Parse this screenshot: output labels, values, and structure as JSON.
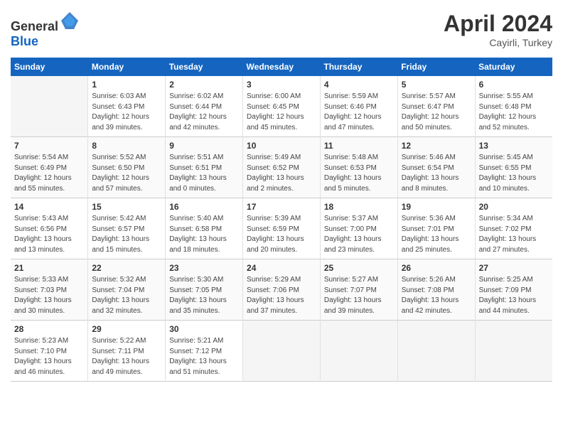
{
  "header": {
    "logo_general": "General",
    "logo_blue": "Blue",
    "month": "April 2024",
    "location": "Cayirli, Turkey"
  },
  "weekdays": [
    "Sunday",
    "Monday",
    "Tuesday",
    "Wednesday",
    "Thursday",
    "Friday",
    "Saturday"
  ],
  "weeks": [
    [
      {
        "day": "",
        "empty": true
      },
      {
        "day": "1",
        "sunrise": "Sunrise: 6:03 AM",
        "sunset": "Sunset: 6:43 PM",
        "daylight": "Daylight: 12 hours and 39 minutes."
      },
      {
        "day": "2",
        "sunrise": "Sunrise: 6:02 AM",
        "sunset": "Sunset: 6:44 PM",
        "daylight": "Daylight: 12 hours and 42 minutes."
      },
      {
        "day": "3",
        "sunrise": "Sunrise: 6:00 AM",
        "sunset": "Sunset: 6:45 PM",
        "daylight": "Daylight: 12 hours and 45 minutes."
      },
      {
        "day": "4",
        "sunrise": "Sunrise: 5:59 AM",
        "sunset": "Sunset: 6:46 PM",
        "daylight": "Daylight: 12 hours and 47 minutes."
      },
      {
        "day": "5",
        "sunrise": "Sunrise: 5:57 AM",
        "sunset": "Sunset: 6:47 PM",
        "daylight": "Daylight: 12 hours and 50 minutes."
      },
      {
        "day": "6",
        "sunrise": "Sunrise: 5:55 AM",
        "sunset": "Sunset: 6:48 PM",
        "daylight": "Daylight: 12 hours and 52 minutes."
      }
    ],
    [
      {
        "day": "7",
        "sunrise": "Sunrise: 5:54 AM",
        "sunset": "Sunset: 6:49 PM",
        "daylight": "Daylight: 12 hours and 55 minutes."
      },
      {
        "day": "8",
        "sunrise": "Sunrise: 5:52 AM",
        "sunset": "Sunset: 6:50 PM",
        "daylight": "Daylight: 12 hours and 57 minutes."
      },
      {
        "day": "9",
        "sunrise": "Sunrise: 5:51 AM",
        "sunset": "Sunset: 6:51 PM",
        "daylight": "Daylight: 13 hours and 0 minutes."
      },
      {
        "day": "10",
        "sunrise": "Sunrise: 5:49 AM",
        "sunset": "Sunset: 6:52 PM",
        "daylight": "Daylight: 13 hours and 2 minutes."
      },
      {
        "day": "11",
        "sunrise": "Sunrise: 5:48 AM",
        "sunset": "Sunset: 6:53 PM",
        "daylight": "Daylight: 13 hours and 5 minutes."
      },
      {
        "day": "12",
        "sunrise": "Sunrise: 5:46 AM",
        "sunset": "Sunset: 6:54 PM",
        "daylight": "Daylight: 13 hours and 8 minutes."
      },
      {
        "day": "13",
        "sunrise": "Sunrise: 5:45 AM",
        "sunset": "Sunset: 6:55 PM",
        "daylight": "Daylight: 13 hours and 10 minutes."
      }
    ],
    [
      {
        "day": "14",
        "sunrise": "Sunrise: 5:43 AM",
        "sunset": "Sunset: 6:56 PM",
        "daylight": "Daylight: 13 hours and 13 minutes."
      },
      {
        "day": "15",
        "sunrise": "Sunrise: 5:42 AM",
        "sunset": "Sunset: 6:57 PM",
        "daylight": "Daylight: 13 hours and 15 minutes."
      },
      {
        "day": "16",
        "sunrise": "Sunrise: 5:40 AM",
        "sunset": "Sunset: 6:58 PM",
        "daylight": "Daylight: 13 hours and 18 minutes."
      },
      {
        "day": "17",
        "sunrise": "Sunrise: 5:39 AM",
        "sunset": "Sunset: 6:59 PM",
        "daylight": "Daylight: 13 hours and 20 minutes."
      },
      {
        "day": "18",
        "sunrise": "Sunrise: 5:37 AM",
        "sunset": "Sunset: 7:00 PM",
        "daylight": "Daylight: 13 hours and 23 minutes."
      },
      {
        "day": "19",
        "sunrise": "Sunrise: 5:36 AM",
        "sunset": "Sunset: 7:01 PM",
        "daylight": "Daylight: 13 hours and 25 minutes."
      },
      {
        "day": "20",
        "sunrise": "Sunrise: 5:34 AM",
        "sunset": "Sunset: 7:02 PM",
        "daylight": "Daylight: 13 hours and 27 minutes."
      }
    ],
    [
      {
        "day": "21",
        "sunrise": "Sunrise: 5:33 AM",
        "sunset": "Sunset: 7:03 PM",
        "daylight": "Daylight: 13 hours and 30 minutes."
      },
      {
        "day": "22",
        "sunrise": "Sunrise: 5:32 AM",
        "sunset": "Sunset: 7:04 PM",
        "daylight": "Daylight: 13 hours and 32 minutes."
      },
      {
        "day": "23",
        "sunrise": "Sunrise: 5:30 AM",
        "sunset": "Sunset: 7:05 PM",
        "daylight": "Daylight: 13 hours and 35 minutes."
      },
      {
        "day": "24",
        "sunrise": "Sunrise: 5:29 AM",
        "sunset": "Sunset: 7:06 PM",
        "daylight": "Daylight: 13 hours and 37 minutes."
      },
      {
        "day": "25",
        "sunrise": "Sunrise: 5:27 AM",
        "sunset": "Sunset: 7:07 PM",
        "daylight": "Daylight: 13 hours and 39 minutes."
      },
      {
        "day": "26",
        "sunrise": "Sunrise: 5:26 AM",
        "sunset": "Sunset: 7:08 PM",
        "daylight": "Daylight: 13 hours and 42 minutes."
      },
      {
        "day": "27",
        "sunrise": "Sunrise: 5:25 AM",
        "sunset": "Sunset: 7:09 PM",
        "daylight": "Daylight: 13 hours and 44 minutes."
      }
    ],
    [
      {
        "day": "28",
        "sunrise": "Sunrise: 5:23 AM",
        "sunset": "Sunset: 7:10 PM",
        "daylight": "Daylight: 13 hours and 46 minutes."
      },
      {
        "day": "29",
        "sunrise": "Sunrise: 5:22 AM",
        "sunset": "Sunset: 7:11 PM",
        "daylight": "Daylight: 13 hours and 49 minutes."
      },
      {
        "day": "30",
        "sunrise": "Sunrise: 5:21 AM",
        "sunset": "Sunset: 7:12 PM",
        "daylight": "Daylight: 13 hours and 51 minutes."
      },
      {
        "day": "",
        "empty": true
      },
      {
        "day": "",
        "empty": true
      },
      {
        "day": "",
        "empty": true
      },
      {
        "day": "",
        "empty": true
      }
    ]
  ]
}
